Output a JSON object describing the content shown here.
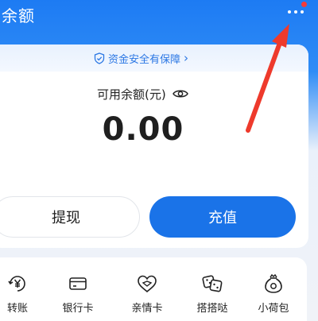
{
  "header": {
    "title": "余额",
    "more_icon": "more-dots-icon",
    "badge_color": "#f23b3b"
  },
  "safety": {
    "text": "资金安全有保障",
    "icon": "shield-check-icon",
    "chevron": "›"
  },
  "balance": {
    "label": "可用余额(元)",
    "visibility_icon": "eye-icon",
    "amount": "0.00"
  },
  "buttons": {
    "withdraw": "提现",
    "recharge": "充值"
  },
  "actions": [
    {
      "label": "转账",
      "icon": "yen-transfer-icon"
    },
    {
      "label": "银行卡",
      "icon": "bank-card-icon"
    },
    {
      "label": "亲情卡",
      "icon": "family-card-icon"
    },
    {
      "label": "搭搭哒",
      "icon": "dice-icon"
    },
    {
      "label": "小荷包",
      "icon": "pouch-icon"
    }
  ],
  "annotation": {
    "arrow_color": "#ee3a2c",
    "points_to": "more-dots-icon"
  },
  "colors": {
    "primary": "#1a73e8",
    "header_blue": "#1d7bf3",
    "safety_text": "#2b77e4"
  }
}
